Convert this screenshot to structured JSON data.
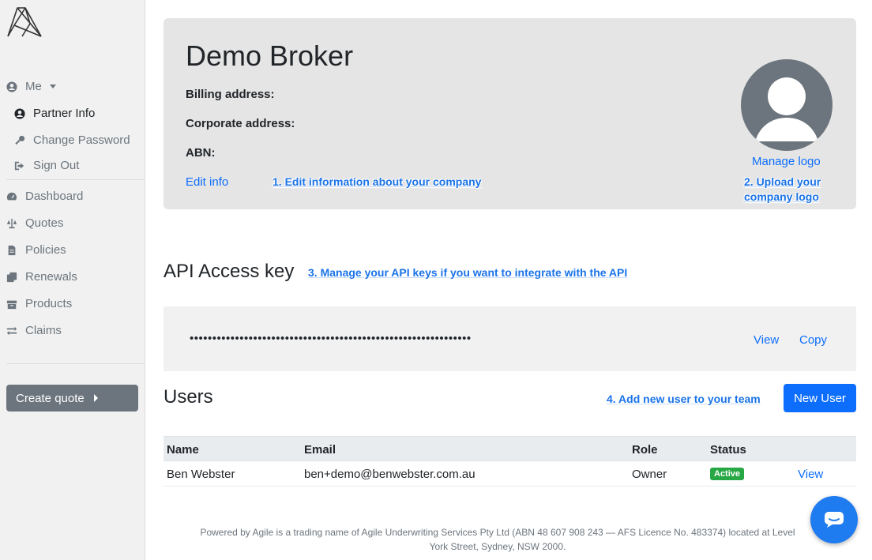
{
  "sidebar": {
    "me_label": "Me",
    "items_me": [
      {
        "label": "Partner Info",
        "icon": "user-circle-icon"
      },
      {
        "label": "Change Password",
        "icon": "key-icon"
      },
      {
        "label": "Sign Out",
        "icon": "sign-out-icon"
      }
    ],
    "items": [
      {
        "label": "Dashboard",
        "icon": "tachometer-icon"
      },
      {
        "label": "Quotes",
        "icon": "balance-scale-icon"
      },
      {
        "label": "Policies",
        "icon": "file-icon"
      },
      {
        "label": "Renewals",
        "icon": "clone-icon"
      },
      {
        "label": "Products",
        "icon": "boxes-icon"
      },
      {
        "label": "Claims",
        "icon": "exchange-icon"
      }
    ],
    "create_quote_label": "Create quote"
  },
  "company": {
    "name": "Demo Broker",
    "billing_label": "Billing address:",
    "corporate_label": "Corporate address:",
    "abn_label": "ABN:",
    "edit_label": "Edit info",
    "manage_logo_label": "Manage logo"
  },
  "annotations": {
    "a1": "1. Edit information about your company",
    "a2_line1": "2. Upload your",
    "a2_line2": "company logo",
    "a3": "3. Manage your API keys if you want to integrate with the API",
    "a4": "4. Add new user to your team"
  },
  "api": {
    "title": "API Access key",
    "masked_key": "••••••••••••••••••••••••••••••••••••••••••••••••••••••••••••••",
    "view_label": "View",
    "copy_label": "Copy"
  },
  "users": {
    "title": "Users",
    "new_user_label": "New User",
    "columns": [
      "Name",
      "Email",
      "Role",
      "Status"
    ],
    "rows": [
      {
        "name": "Ben Webster",
        "email": "ben+demo@benwebster.com.au",
        "role": "Owner",
        "status": "Active",
        "action": "View"
      }
    ]
  },
  "footer": {
    "line1": "Powered by Agile is a trading name of Agile Underwriting Services Pty Ltd (ABN 48 607 908 243 — AFS Licence No. 483374) located at Level",
    "line2": "York Street, Sydney, NSW 2000."
  },
  "colors": {
    "primary": "#0d6efd",
    "success": "#28a745",
    "secondary": "#6c757d",
    "annotation": "#1a73e8"
  }
}
